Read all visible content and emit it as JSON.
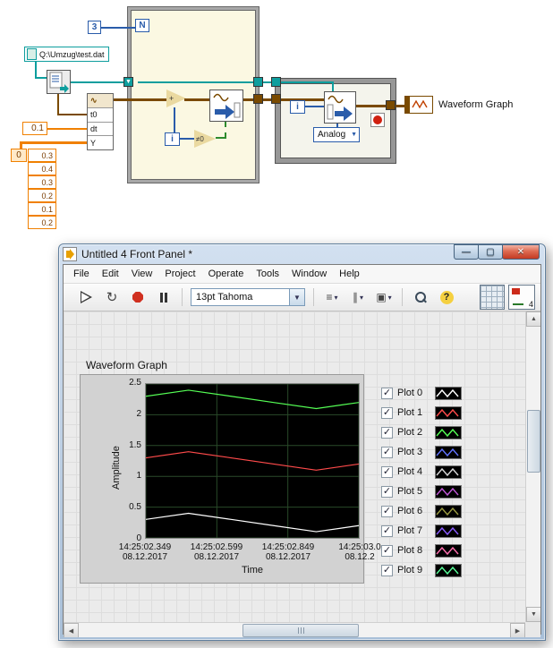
{
  "block_diagram": {
    "loop_count_value": "3",
    "count_terminal": "N",
    "file_path_constant": "Q:\\Umzug\\test.dat",
    "dt_constant": "0.1",
    "build_waveform": {
      "rows": [
        "t0",
        "dt",
        "Y"
      ]
    },
    "array_index": "0",
    "array_values": [
      "0.3",
      "0.4",
      "0.3",
      "0.2",
      "0.1",
      "0.2"
    ],
    "iteration_terminal": "i",
    "not_equal_zero": "≠0",
    "ring_constant": "Analog",
    "graph_terminal_label": "Waveform Graph",
    "wire_colors": {
      "integer": "#2a5caa",
      "float": "#f08000",
      "path": "#0e9e9e",
      "waveform": "#7a4a00",
      "boolean": "#2e8b2e"
    }
  },
  "window": {
    "title": "Untitled 4 Front Panel *",
    "menu_items": [
      "File",
      "Edit",
      "View",
      "Project",
      "Operate",
      "Tools",
      "Window",
      "Help"
    ],
    "toolbar": {
      "font_selector": "13pt Tahoma",
      "badge": "4",
      "icons": [
        "run",
        "run-continuously",
        "abort",
        "pause",
        "align-objects",
        "distribute-objects",
        "reorder-objects",
        "search",
        "help",
        "grid",
        "panel-badge"
      ]
    }
  },
  "front_panel": {
    "graph_label": "Waveform Graph",
    "y_axis_label": "Amplitude",
    "x_axis_label": "Time",
    "y_ticks": [
      "2.5",
      "2",
      "1.5",
      "1",
      "0.5",
      "0"
    ],
    "x_ticks": [
      {
        "time": "14:25:02.349",
        "date": "08.12.2017"
      },
      {
        "time": "14:25:02.599",
        "date": "08.12.2017"
      },
      {
        "time": "14:25:02.849",
        "date": "08.12.2017"
      },
      {
        "time": "14:25:03.0",
        "date": "08.12.2"
      }
    ],
    "legend": [
      {
        "label": "Plot 0",
        "color": "#ffffff"
      },
      {
        "label": "Plot 1",
        "color": "#ff4b4b"
      },
      {
        "label": "Plot 2",
        "color": "#55ff55"
      },
      {
        "label": "Plot 3",
        "color": "#6273ff"
      },
      {
        "label": "Plot 4",
        "color": "#d8d8d8"
      },
      {
        "label": "Plot 5",
        "color": "#c058d8"
      },
      {
        "label": "Plot 6",
        "color": "#9a9a40"
      },
      {
        "label": "Plot 7",
        "color": "#8a5cff"
      },
      {
        "label": "Plot 8",
        "color": "#ff6fb0"
      },
      {
        "label": "Plot 9",
        "color": "#58ff9a"
      }
    ]
  },
  "chart_data": {
    "type": "line",
    "title": "Waveform Graph",
    "xlabel": "Time",
    "ylabel": "Amplitude",
    "ylim": [
      0,
      2.5
    ],
    "y_ticks": [
      0,
      0.5,
      1,
      1.5,
      2,
      2.5
    ],
    "x_tick_labels": [
      "14:25:02.349 08.12.2017",
      "14:25:02.599 08.12.2017",
      "14:25:02.849 08.12.2017",
      "14:25:03.0 08.12.2"
    ],
    "dt_s": 0.1,
    "grid": true,
    "legend_position": "right",
    "plot_bg": "#000000",
    "series": [
      {
        "name": "Plot 0",
        "color": "#ffffff",
        "values": [
          0.3,
          0.4,
          0.3,
          0.2,
          0.1,
          0.2
        ]
      },
      {
        "name": "Plot 1",
        "color": "#ff4b4b",
        "values": [
          1.3,
          1.4,
          1.3,
          1.2,
          1.1,
          1.2
        ]
      },
      {
        "name": "Plot 2",
        "color": "#55ff55",
        "values": [
          2.3,
          2.4,
          2.3,
          2.2,
          2.1,
          2.2
        ]
      }
    ]
  }
}
